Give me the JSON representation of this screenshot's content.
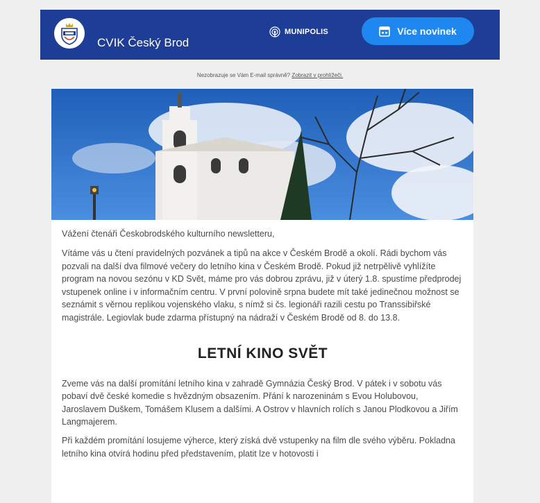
{
  "header": {
    "brand_name": "CVIK Český Brod",
    "partner_logo": "MUNIPOLIS",
    "more_news_label": "Více novinek",
    "more_news_icon": "calendar-icon",
    "colors": {
      "header_bg": "#1e3d96",
      "button_bg": "#1e88f0"
    }
  },
  "browser_note": {
    "text": "Nezobrazuje se Vám E-mail správně?",
    "link": "Zobrazit v prohlížeči."
  },
  "content": {
    "greeting": "Vážení čtenáři Českobrodského kulturního newsletteru,",
    "intro": "Vítáme vás u čtení pravidelných pozvánek a tipů na akce v Českém Brodě a okolí. Rádi bychom vás pozvali na další dva filmové večery do letního kina v Českém Brodě. Pokud již netrpělivě vyhlížíte program na novou sezónu v KD Svět, máme pro vás dobrou zprávu, již v úterý 1.8. spustíme předprodej vstupenek online i v informačním centru. V první polovině srpna budete mít také jedinečnou možnost se seznámit s věrnou replikou vojenského vlaku, s nímž si čs. legionáři razili cestu po Transsibiřské magistrále. Legiovlak bude zdarma přístupný na nádraží v Českém Brodě od 8. do 13.8.",
    "section_title": "LETNÍ KINO SVĚT",
    "paragraph1": "Zveme vás na další promítání letního kina v zahradě Gymnázia Český Brod. V pátek i v sobotu vás pobaví dvě české komedie s hvězdným obsazením. Přání k narozeninám s Evou Holubovou, Jaroslavem Duškem, Tomášem Klusem a dalšími. A Ostrov v hlavních rolích s Janou Plodkovou a Jiřím Langmajerem.",
    "paragraph2": "Při každém promítání losujeme výherce, který získá dvě vstupenky na film dle svého výběru. Pokladna letního kina otvírá hodinu před představením, platit lze v hotovosti i"
  }
}
